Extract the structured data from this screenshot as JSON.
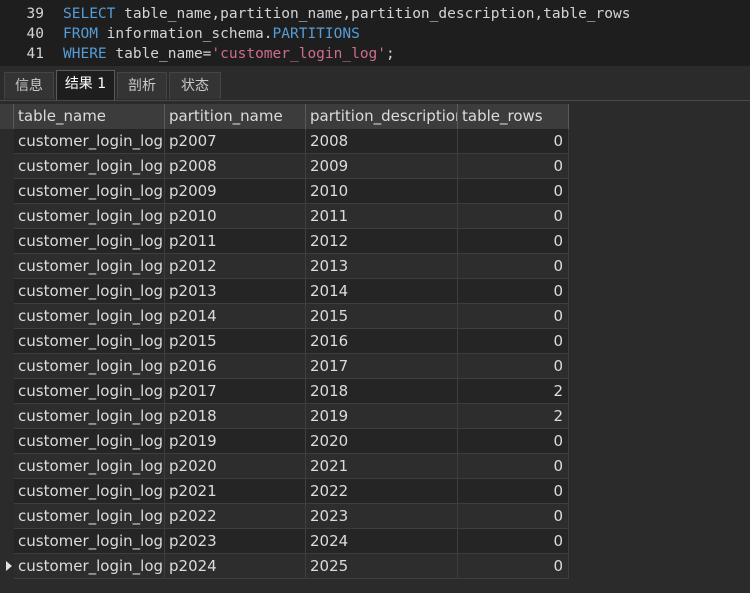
{
  "editor": {
    "lines": [
      {
        "num": "39",
        "parts": [
          {
            "t": "kw",
            "v": "SELECT"
          },
          {
            "t": "tx",
            "v": " table_name,partition_name,partition_description,table_rows"
          }
        ]
      },
      {
        "num": "40",
        "parts": [
          {
            "t": "kw",
            "v": "FROM"
          },
          {
            "t": "tx",
            "v": " information_schema."
          },
          {
            "t": "kw",
            "v": "PARTITIONS"
          }
        ]
      },
      {
        "num": "41",
        "parts": [
          {
            "t": "kw",
            "v": "WHERE"
          },
          {
            "t": "tx",
            "v": " table_name="
          },
          {
            "t": "str",
            "v": "'customer_login_log'"
          },
          {
            "t": "tx",
            "v": ";"
          }
        ]
      }
    ]
  },
  "tabs": [
    {
      "label": "信息",
      "active": false
    },
    {
      "label": "结果 1",
      "active": true
    },
    {
      "label": "剖析",
      "active": false
    },
    {
      "label": "状态",
      "active": false
    }
  ],
  "table": {
    "columns": [
      "table_name",
      "partition_name",
      "partition_description",
      "table_rows"
    ],
    "rows": [
      [
        "customer_login_log",
        "p2007",
        "2008",
        "0"
      ],
      [
        "customer_login_log",
        "p2008",
        "2009",
        "0"
      ],
      [
        "customer_login_log",
        "p2009",
        "2010",
        "0"
      ],
      [
        "customer_login_log",
        "p2010",
        "2011",
        "0"
      ],
      [
        "customer_login_log",
        "p2011",
        "2012",
        "0"
      ],
      [
        "customer_login_log",
        "p2012",
        "2013",
        "0"
      ],
      [
        "customer_login_log",
        "p2013",
        "2014",
        "0"
      ],
      [
        "customer_login_log",
        "p2014",
        "2015",
        "0"
      ],
      [
        "customer_login_log",
        "p2015",
        "2016",
        "0"
      ],
      [
        "customer_login_log",
        "p2016",
        "2017",
        "0"
      ],
      [
        "customer_login_log",
        "p2017",
        "2018",
        "2"
      ],
      [
        "customer_login_log",
        "p2018",
        "2019",
        "2"
      ],
      [
        "customer_login_log",
        "p2019",
        "2020",
        "0"
      ],
      [
        "customer_login_log",
        "p2020",
        "2021",
        "0"
      ],
      [
        "customer_login_log",
        "p2021",
        "2022",
        "0"
      ],
      [
        "customer_login_log",
        "p2022",
        "2023",
        "0"
      ],
      [
        "customer_login_log",
        "p2023",
        "2024",
        "0"
      ],
      [
        "customer_login_log",
        "p2024",
        "2025",
        "0"
      ]
    ],
    "current_row": 17
  },
  "colors": {
    "keyword": "#569cd6",
    "string": "#ce6e8c",
    "editor_bg": "#1e1e1e",
    "grid_bg": "#2b2b2b"
  }
}
